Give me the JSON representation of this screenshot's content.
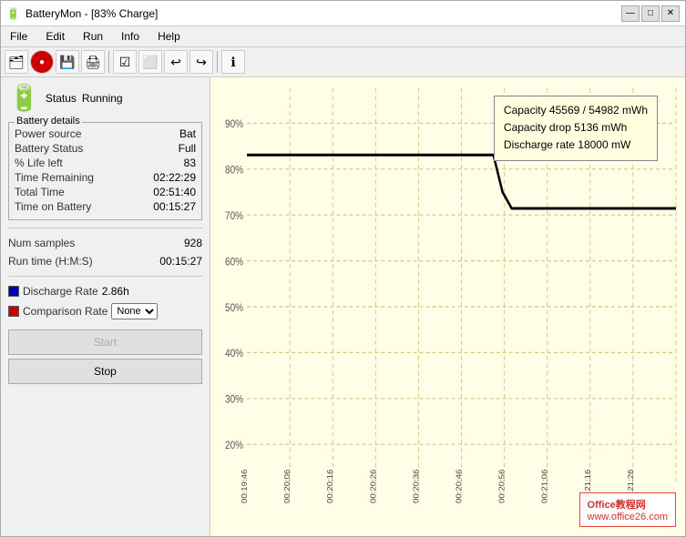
{
  "window": {
    "title": "BatteryMon - [83% Charge]",
    "icon": "🔋"
  },
  "titlebar": {
    "minimize": "—",
    "maximize": "□",
    "close": "✕"
  },
  "menu": {
    "items": [
      "File",
      "Edit",
      "Run",
      "Info",
      "Help"
    ]
  },
  "toolbar": {
    "icons": [
      "🗂",
      "🔴",
      "💾",
      "🖨",
      "☑",
      "⬜",
      "↩",
      "↪",
      "🔵"
    ]
  },
  "left": {
    "status_label": "Status",
    "status_value": "Running",
    "group_title": "Battery details",
    "rows": [
      {
        "label": "Power source",
        "value": "Bat"
      },
      {
        "label": "Battery Status",
        "value": "Full"
      },
      {
        "label": "% Life left",
        "value": "83"
      },
      {
        "label": "Time Remaining",
        "value": "02:22:29"
      },
      {
        "label": "Total Time",
        "value": "02:51:40"
      },
      {
        "label": "Time on Battery",
        "value": "00:15:27"
      }
    ],
    "samples_label": "Num samples",
    "samples_value": "928",
    "runtime_label": "Run time (H:M:S)",
    "runtime_value": "00:15:27",
    "discharge_label": "Discharge Rate",
    "discharge_value": "2.86h",
    "discharge_color": "#0000bb",
    "comparison_label": "Comparison Rate",
    "comparison_color": "#cc0000",
    "comparison_options": [
      "None"
    ],
    "comparison_selected": "None",
    "btn_start": "Start",
    "btn_stop": "Stop"
  },
  "chart": {
    "tooltip": {
      "line1": "Capacity 45569 / 54982 mWh",
      "line2": "Capacity drop 5136 mWh",
      "line3": "Discharge rate 18000 mW"
    },
    "y_labels": [
      "90%",
      "80%",
      "70%",
      "60%",
      "50%",
      "40%",
      "30%",
      "20%"
    ],
    "x_labels": [
      "00:19:46",
      "00:20:06",
      "00:20:16",
      "00:20:26",
      "00:20:36",
      "00:20:46",
      "00:20:56",
      "00:21:06",
      "00:21:16",
      "00:21:26"
    ]
  },
  "watermark": {
    "line1": "Office教程网",
    "line2": "www.office26.com"
  }
}
